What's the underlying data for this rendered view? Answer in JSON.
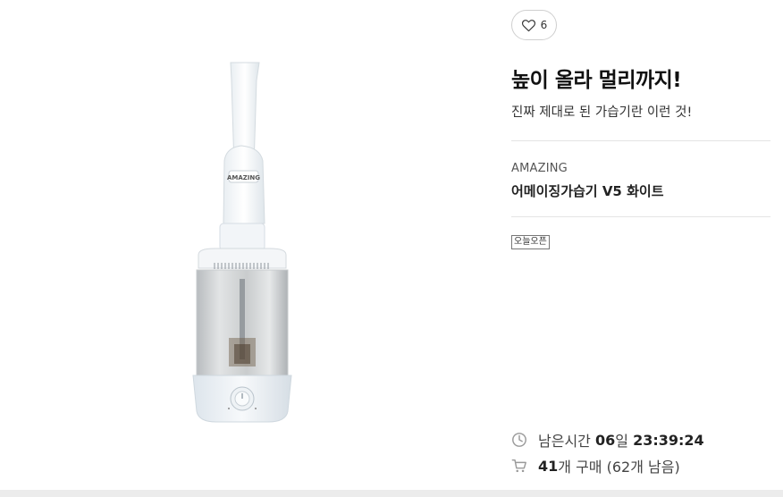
{
  "product": {
    "image_alt": "어메이징가습기 V5 화이트",
    "image_label": "AMAZING",
    "like_count": "6",
    "headline": "높이 올라 멀리까지!",
    "subline": "진짜 제대로 된 가습기란 이런 것!",
    "brand": "AMAZING",
    "name": "어메이징가습기 V5 화이트",
    "badge": "오늘오픈"
  },
  "timer": {
    "label": "남은시간",
    "days": "06",
    "days_unit": "일",
    "time": "23:39:24"
  },
  "purchase": {
    "count": "41",
    "count_unit": "개 구매",
    "remaining": "(62개 남음)"
  },
  "icons": {
    "like": "heart-outline-icon",
    "timer": "clock-icon",
    "purchase": "cart-icon"
  },
  "colors": {
    "text_primary": "#222222",
    "text_secondary": "#555555",
    "divider": "#e4e4e4",
    "icon_gray": "#9a9a9a"
  }
}
